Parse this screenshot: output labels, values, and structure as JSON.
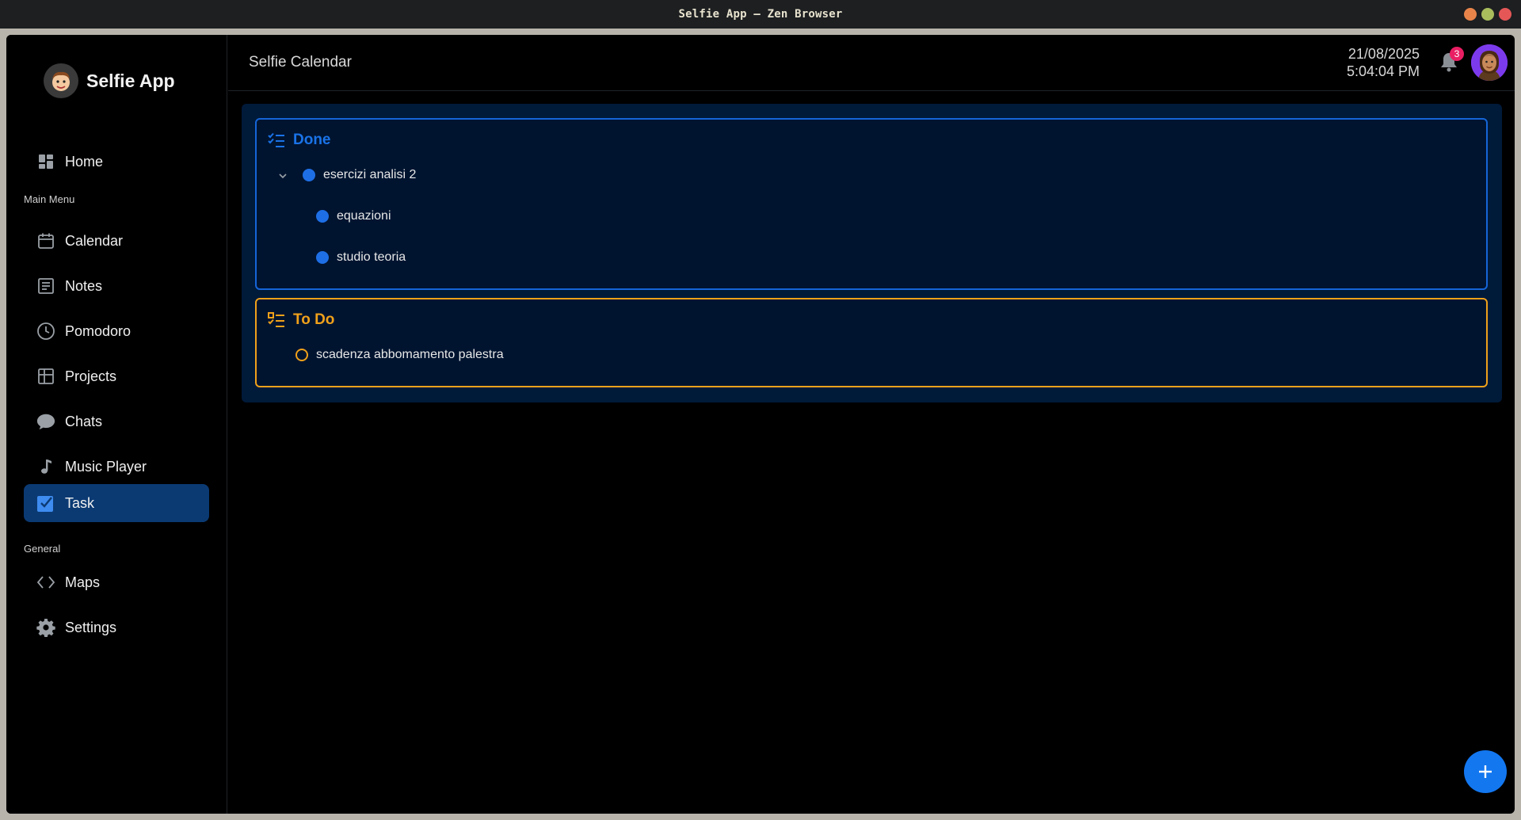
{
  "window": {
    "title": "Selfie App — Zen Browser",
    "controls": [
      {
        "name": "minimize",
        "color": "#e8844a"
      },
      {
        "name": "maximize",
        "color": "#a9bd5d"
      },
      {
        "name": "close",
        "color": "#e55757"
      }
    ]
  },
  "sidebar": {
    "brand": "Selfie App",
    "home": {
      "label": "Home",
      "icon": "dashboard-icon"
    },
    "main_menu_label": "Main Menu",
    "main_items": [
      {
        "label": "Calendar",
        "icon": "calendar-icon"
      },
      {
        "label": "Notes",
        "icon": "notes-icon"
      },
      {
        "label": "Pomodoro",
        "icon": "clock-icon"
      },
      {
        "label": "Projects",
        "icon": "projects-icon"
      },
      {
        "label": "Chats",
        "icon": "chat-bubble-icon"
      },
      {
        "label": "Music Player",
        "icon": "music-note-icon"
      },
      {
        "label": "Task",
        "icon": "task-check-icon",
        "active": true
      }
    ],
    "general_label": "General",
    "general_items": [
      {
        "label": "Maps",
        "icon": "code-brackets-icon"
      },
      {
        "label": "Settings",
        "icon": "gear-icon"
      }
    ]
  },
  "header": {
    "title": "Selfie Calendar",
    "date": "21/08/2025",
    "time": "5:04:04 PM",
    "notification_count": "3"
  },
  "tasks": {
    "done": {
      "title": "Done",
      "color": "#1a73e8",
      "items": [
        {
          "label": "esercizi analisi 2",
          "expanded": true,
          "children": [
            {
              "label": "equazioni"
            },
            {
              "label": "studio teoria"
            }
          ]
        }
      ]
    },
    "todo": {
      "title": "To Do",
      "color": "#f0a11a",
      "items": [
        {
          "label": "scadenza abbomamento palestra"
        }
      ]
    }
  },
  "fab": {
    "icon": "plus-icon"
  }
}
